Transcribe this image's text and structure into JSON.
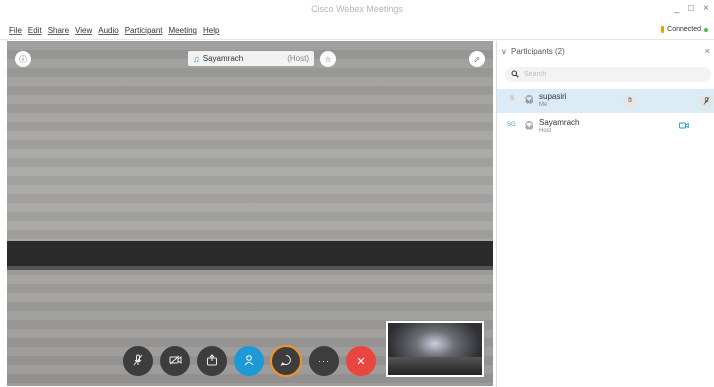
{
  "window": {
    "title": "Cisco Webex Meetings",
    "minimize": "_",
    "maximize": "□",
    "close": "×"
  },
  "menu": [
    "File",
    "Edit",
    "Share",
    "View",
    "Audio",
    "Participant",
    "Meeting",
    "Help"
  ],
  "connection": {
    "label": "Connected",
    "color": "#55b84a"
  },
  "stage": {
    "active_speaker": {
      "name": "Sayamrach",
      "role": "(Host)"
    }
  },
  "controls": [
    {
      "name": "mute-button",
      "icon": "mic-off-icon",
      "glyph": "🎙"
    },
    {
      "name": "video-button",
      "icon": "video-off-icon",
      "glyph": "⊘"
    },
    {
      "name": "share-button",
      "icon": "share-icon",
      "glyph": "⇪"
    },
    {
      "name": "participants-button",
      "icon": "participants-icon",
      "glyph": "👤"
    },
    {
      "name": "chat-button",
      "icon": "chat-icon",
      "glyph": "◯"
    },
    {
      "name": "more-button",
      "icon": "more-icon",
      "glyph": "···"
    },
    {
      "name": "leave-button",
      "icon": "close-icon",
      "glyph": "✕"
    }
  ],
  "participants_panel": {
    "title": "Participants (2)",
    "search_placeholder": "Search",
    "rows": [
      {
        "initials": "S",
        "name": "supasiri",
        "sub": "Me",
        "selected": true
      },
      {
        "initials": "SG",
        "name": "Sayamrach",
        "sub": "Host",
        "selected": false
      }
    ]
  },
  "colors": {
    "accent": "#1d9ad6",
    "leave": "#e8463f",
    "ring": "#f0932b"
  }
}
